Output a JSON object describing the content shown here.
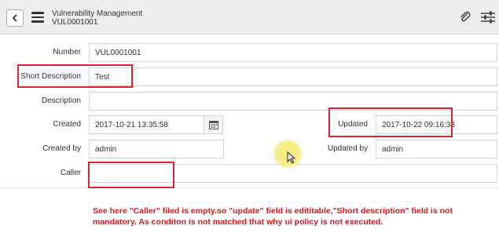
{
  "header": {
    "title": "Vulnerability Management",
    "record_id": "VUL0001001",
    "back_icon": "chevron-left-icon",
    "menu_icon": "hamburger-icon",
    "attachment_icon": "paperclip-icon",
    "settings_icon": "sliders-icon"
  },
  "form": {
    "number": {
      "label": "Number",
      "value": "VUL0001001"
    },
    "short_description": {
      "label": "Short Description",
      "value": "Test"
    },
    "description": {
      "label": "Description",
      "value": ""
    },
    "created": {
      "label": "Created",
      "value": "2017-10-21 13:35:58",
      "icon": "calendar-icon"
    },
    "updated": {
      "label": "Updated",
      "value": "2017-10-22 09:16:38"
    },
    "created_by": {
      "label": "Created by",
      "value": "admin"
    },
    "updated_by": {
      "label": "Updated by",
      "value": "admin"
    },
    "caller": {
      "label": "Caller",
      "value": ""
    }
  },
  "annotation": {
    "line1": "See here \"Caller\" filed is empty.so \"update\" field is edititable,\"Short description\" field is not",
    "line2": "mandatory. As conditon is not matched that why ui policy is not executed."
  },
  "colors": {
    "highlight_box": "#d9252f",
    "annotation_text": "#e0141c",
    "header_bg": "#eceef0"
  }
}
